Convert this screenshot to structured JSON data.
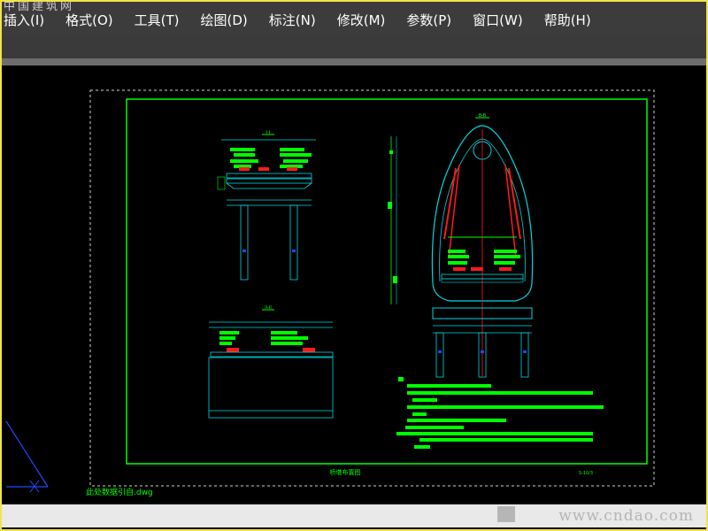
{
  "menubar": {
    "items": [
      {
        "label": "插入(I)"
      },
      {
        "label": "格式(O)"
      },
      {
        "label": "工具(T)"
      },
      {
        "label": "绘图(D)"
      },
      {
        "label": "标注(N)"
      },
      {
        "label": "修改(M)"
      },
      {
        "label": "参数(P)"
      },
      {
        "label": "窗口(W)"
      },
      {
        "label": "帮助(H)"
      }
    ]
  },
  "watermarks": {
    "top_left": "中国建筑网",
    "bottom_right": "www.cndao.com"
  },
  "drawing": {
    "title": "桥墩布置图",
    "sheet_no": "S-10/3",
    "section_marks": {
      "top_left": "I-I",
      "bottom_left": "II-II",
      "right": "B-B"
    },
    "side_text": "比例尺",
    "command_line": "此处数据引自.dwg"
  },
  "colors": {
    "background": "#000000",
    "menubar": "#3c3c3c",
    "border": "#f2e34a",
    "green": "#00ff00",
    "cyan": "#00d8e0",
    "red": "#ff1a1a",
    "blue": "#1e48ff"
  }
}
